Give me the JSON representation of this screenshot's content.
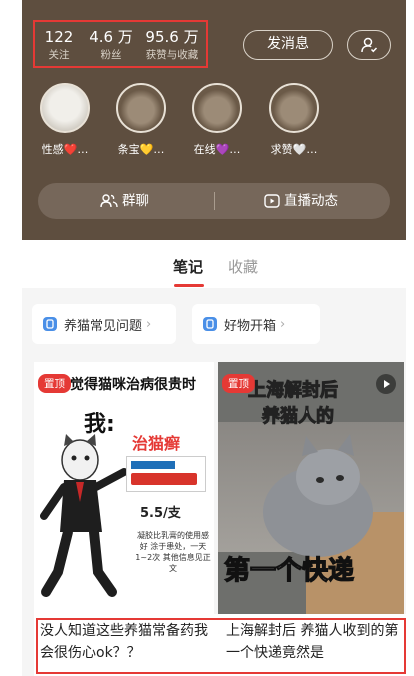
{
  "stats": [
    {
      "value": "122",
      "label": "关注"
    },
    {
      "value": "4.6 万",
      "label": "粉丝"
    },
    {
      "value": "95.6 万",
      "label": "获赞与收藏"
    }
  ],
  "header_buttons": {
    "message": "发消息"
  },
  "groups": [
    {
      "label": "性感❤️…"
    },
    {
      "label": "条宝💛…"
    },
    {
      "label": "在线💜…"
    },
    {
      "label": "求赞🤍…"
    }
  ],
  "actions": {
    "group_chat": "群聊",
    "live": "直播动态"
  },
  "tabs": [
    {
      "label": "笔记",
      "active": true
    },
    {
      "label": "收藏",
      "active": false
    }
  ],
  "collections": [
    {
      "label": "养猫常见问题"
    },
    {
      "label": "好物开箱"
    }
  ],
  "notes": [
    {
      "badge": "置顶",
      "headline": "觉得猫咪治病很贵时",
      "wo": "我:",
      "drug": "治猫癣",
      "price": "5.5/支",
      "desc": "凝胶比乳膏的使用感好 涂于患处，一天1~2次 其他信息见正文",
      "title": "没人知道这些养猫常备药我会很伤心ok？？"
    },
    {
      "badge": "置顶",
      "caption_line1": "上海解封后",
      "caption_line2": "养猫人的",
      "caption_big": "第一个快递",
      "title": "上海解封后 养猫人收到的第一个快递竟然是"
    }
  ],
  "colors": {
    "header_bg": "#5e4e3f",
    "accent": "#e53935"
  }
}
